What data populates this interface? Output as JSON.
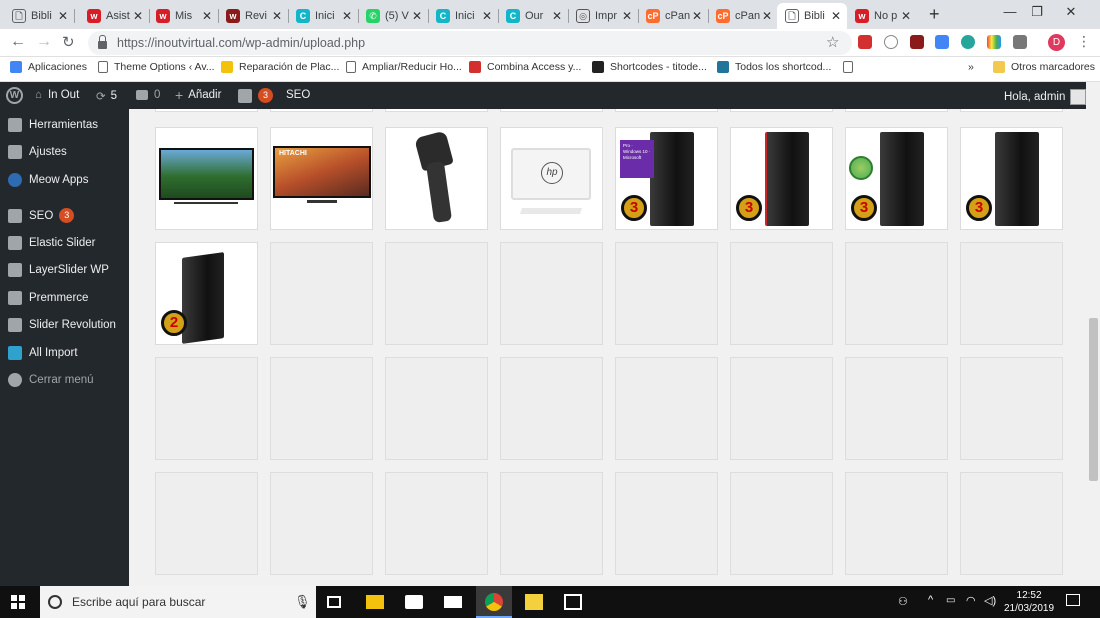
{
  "browser": {
    "tabs": [
      {
        "title": "Bibli",
        "color": "#5f6368",
        "glyph": "🗋"
      },
      {
        "title": "Asist",
        "color": "#d71e28",
        "glyph": "w"
      },
      {
        "title": "Mis",
        "color": "#d71e28",
        "glyph": "w"
      },
      {
        "title": "Revi",
        "color": "#8b1a1a",
        "glyph": "w"
      },
      {
        "title": "Inici",
        "color": "#13b5c8",
        "glyph": "C"
      },
      {
        "title": "(5) V",
        "color": "#25d366",
        "glyph": "✆"
      },
      {
        "title": "Inici",
        "color": "#13b5c8",
        "glyph": "C"
      },
      {
        "title": "Our",
        "color": "#13b5c8",
        "glyph": "C"
      },
      {
        "title": "Impr",
        "color": "#555555",
        "glyph": "◎"
      },
      {
        "title": "cPan",
        "color": "#ff6c2c",
        "glyph": "cP"
      },
      {
        "title": "cPan",
        "color": "#ff6c2c",
        "glyph": "cP"
      },
      {
        "title": "Bibli",
        "color": "#5f6368",
        "glyph": "🗋"
      },
      {
        "title": "No p",
        "color": "#d71e28",
        "glyph": "w"
      }
    ],
    "active_tab": 11,
    "url": "https://inoutvirtual.com/wp-admin/upload.php",
    "bookmarks": [
      {
        "label": "Aplicaciones",
        "color": "#4285f4"
      },
      {
        "label": "Theme Options ‹ Av...",
        "color": "#ffffff"
      },
      {
        "label": "Reparación de Plac...",
        "color": "#f4c20d"
      },
      {
        "label": "Ampliar/Reducir Ho...",
        "color": "#ffffff"
      },
      {
        "label": "Combina Access y...",
        "color": "#d32f2f"
      },
      {
        "label": "Shortcodes - titode...",
        "color": "#222222"
      },
      {
        "label": "Todos los shortcod...",
        "color": "#21759b"
      },
      {
        "label": "",
        "color": "#ffffff"
      }
    ],
    "other_bookmarks": "Otros marcadores",
    "profile_initial": "D"
  },
  "adminbar": {
    "site": "In Out",
    "updates": "5",
    "comments": "0",
    "add_new": "Añadir",
    "seo_count": "3",
    "seo": "SEO",
    "greeting": "Hola, admin"
  },
  "sidebar": {
    "items": [
      {
        "label": "Herramientas",
        "icon": "wrench-icon"
      },
      {
        "label": "Ajustes",
        "icon": "settings-icon"
      },
      {
        "label": "Meow Apps",
        "icon": "meow-icon"
      },
      {
        "label": "SEO",
        "icon": "yoast-icon",
        "badge": "3"
      },
      {
        "label": "Elastic Slider",
        "icon": "pin-icon"
      },
      {
        "label": "LayerSlider WP",
        "icon": "layers-icon"
      },
      {
        "label": "Premmerce",
        "icon": "cart-icon"
      },
      {
        "label": "Slider Revolution",
        "icon": "gear-icon"
      },
      {
        "label": "All Import",
        "icon": "import-icon"
      },
      {
        "label": "Cerrar menú",
        "icon": "collapse-icon"
      }
    ]
  },
  "media": {
    "images": [
      {
        "name": "tv-football"
      },
      {
        "name": "tv-hitachi",
        "brand": "HITACHI"
      },
      {
        "name": "barcode-scanner"
      },
      {
        "name": "hp-all-in-one",
        "brand": "hp"
      },
      {
        "name": "pc-tower-windows",
        "badge": "3",
        "sticker": "Pro · Windows 10 · Microsoft"
      },
      {
        "name": "pc-tower-red",
        "badge": "3"
      },
      {
        "name": "pc-tower-eco",
        "badge": "3"
      },
      {
        "name": "pc-tower-black",
        "badge": "3"
      },
      {
        "name": "pc-tower-small",
        "badge": "2"
      }
    ],
    "placeholder_count": 23
  },
  "taskbar": {
    "search_placeholder": "Escribe aquí para buscar",
    "time": "12:52",
    "date": "21/03/2019"
  }
}
